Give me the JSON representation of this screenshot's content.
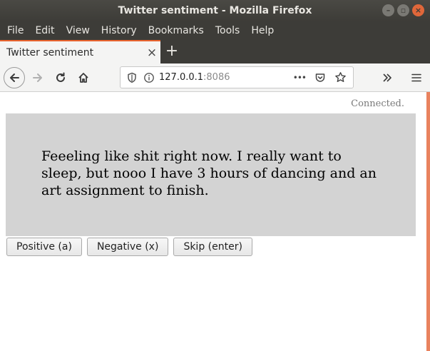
{
  "window": {
    "title": "Twitter sentiment - Mozilla Firefox",
    "minimize": "–",
    "maximize": "▫",
    "close": "×"
  },
  "menu": [
    "File",
    "Edit",
    "View",
    "History",
    "Bookmarks",
    "Tools",
    "Help"
  ],
  "tab": {
    "title": "Twitter sentiment",
    "close": "×",
    "new_tab": "+"
  },
  "nav": {
    "url_host": "127.0.0.1",
    "url_port": ":8086",
    "page_actions": "•••"
  },
  "page": {
    "status": "Connected.",
    "tweet": "Feeeling like shit right now. I really want to sleep, but nooo I have 3 hours of dancing and an art assignment to finish.",
    "buttons": {
      "positive": "Positive (a)",
      "negative": "Negative (x)",
      "skip": "Skip (enter)"
    }
  },
  "colors": {
    "accent": "#e9632e",
    "tweet_background": "#d3d3d3",
    "chrome_dark": "#3d3c38"
  }
}
